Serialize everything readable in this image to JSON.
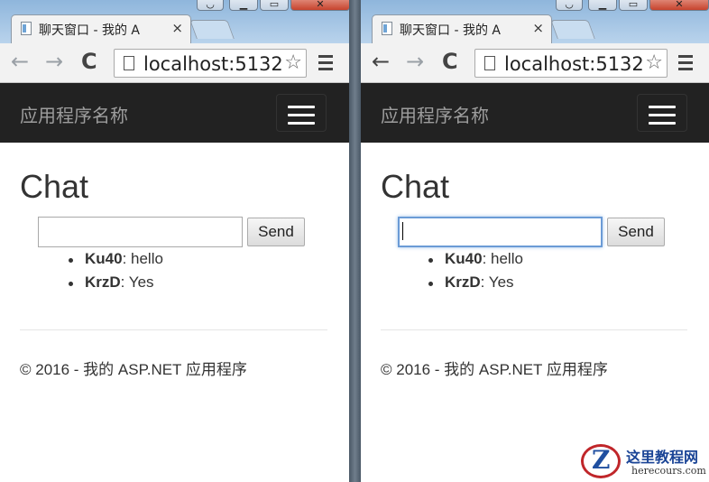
{
  "browser": {
    "tab_title": "聊天窗口 - 我的 A",
    "url": "localhost:5132",
    "close_glyph": "×",
    "star_glyph": "☆",
    "back_glyph": "←",
    "forward_glyph": "→",
    "reload_glyph": "C"
  },
  "app": {
    "brand": "应用程序名称",
    "heading": "Chat",
    "send_label": "Send",
    "input_value": "",
    "messages": [
      {
        "user": "Ku40",
        "text": ": hello"
      },
      {
        "user": "KrzD",
        "text": ": Yes"
      }
    ],
    "footer": "© 2016 - 我的 ASP.NET 应用程序"
  },
  "watermark": {
    "letter": "Z",
    "title": "这里教程网",
    "domain": "herecours.com"
  },
  "colors": {
    "navbar": "#222222",
    "brand_text": "#9d9d9d",
    "focus_ring": "#6b9bd6",
    "logo_red": "#c0262a",
    "logo_blue": "#1a4496"
  },
  "icons": [
    "back-arrow-icon",
    "forward-arrow-icon",
    "reload-icon",
    "page-icon",
    "star-icon",
    "menu-icon",
    "hamburger-icon",
    "tab-close-icon",
    "favicon-icon"
  ]
}
